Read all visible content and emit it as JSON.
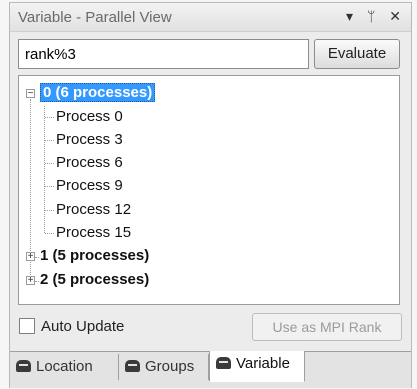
{
  "window": {
    "title": "Variable - Parallel View",
    "icons": [
      "dropdown-arrow-icon",
      "pin-icon",
      "close-icon"
    ],
    "dropdown_glyph": "▾",
    "pin_glyph": "ᛘ",
    "close_glyph": "✕"
  },
  "expression": {
    "value": "rank%3",
    "evaluate_label": "Evaluate"
  },
  "tree": {
    "groups": [
      {
        "label": "0 (6 processes)",
        "expanded": true,
        "selected": true,
        "children": [
          "Process 0",
          "Process 3",
          "Process 6",
          "Process 9",
          "Process 12",
          "Process 15"
        ]
      },
      {
        "label": "1 (5 processes)",
        "expanded": false,
        "selected": false,
        "children": []
      },
      {
        "label": "2 (5 processes)",
        "expanded": false,
        "selected": false,
        "children": []
      }
    ]
  },
  "bottom": {
    "auto_update_label": "Auto Update",
    "auto_update_checked": false,
    "mpi_button_label": "Use as MPI Rank"
  },
  "tabs": [
    {
      "label": "Location",
      "active": false
    },
    {
      "label": "Groups",
      "active": false
    },
    {
      "label": "Variable",
      "active": true
    }
  ],
  "colors": {
    "selection": "#3399ff",
    "disabled_text": "#9b9b9b"
  }
}
